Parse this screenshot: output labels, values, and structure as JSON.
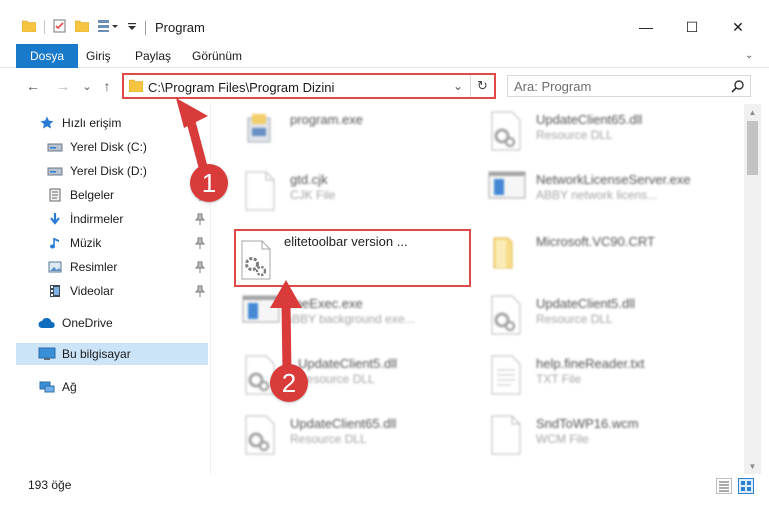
{
  "window": {
    "title": "Program",
    "minimize_glyph": "—",
    "maximize_glyph": "☐",
    "close_glyph": "✕"
  },
  "ribbon": {
    "tabs": [
      {
        "label": "Dosya",
        "active": true
      },
      {
        "label": "Giriş",
        "active": false
      },
      {
        "label": "Paylaş",
        "active": false
      },
      {
        "label": "Görünüm",
        "active": false
      }
    ],
    "expand_glyph": "⌄"
  },
  "navigation": {
    "back_glyph": "←",
    "forward_glyph": "→",
    "recent_glyph": "⌄",
    "up_glyph": "↑",
    "address": "C:\\Program Files\\Program Dizini",
    "address_drop_glyph": "⌄",
    "refresh_glyph": "↻",
    "search_placeholder": "Ara: Program"
  },
  "sidebar": {
    "items": [
      {
        "label": "Hızlı erişim",
        "icon": "star-icon",
        "pinned": false
      },
      {
        "label": "Yerel Disk (C:)",
        "icon": "drive-icon",
        "pinned": true
      },
      {
        "label": "Yerel Disk (D:)",
        "icon": "drive-icon",
        "pinned": true
      },
      {
        "label": "Belgeler",
        "icon": "documents-icon",
        "pinned": true
      },
      {
        "label": "İndirmeler",
        "icon": "download-icon",
        "pinned": true
      },
      {
        "label": "Müzik",
        "icon": "music-icon",
        "pinned": true
      },
      {
        "label": "Resimler",
        "icon": "pictures-icon",
        "pinned": true
      },
      {
        "label": "Videolar",
        "icon": "video-icon",
        "pinned": true
      },
      {
        "label": "OneDrive",
        "icon": "cloud-icon",
        "pinned": false
      },
      {
        "label": "Bu bilgisayar",
        "icon": "computer-icon",
        "pinned": false,
        "selected": true
      },
      {
        "label": "Ağ",
        "icon": "network-icon",
        "pinned": false
      }
    ],
    "pin_glyph": "📌"
  },
  "files": [
    {
      "name": "program.exe",
      "type": "",
      "icon": "installer-icon",
      "blurred": true
    },
    {
      "name": "UpdateClient65.dll",
      "type": "Resource DLL",
      "icon": "dll-icon",
      "blurred": true
    },
    {
      "name": "gtd.cjk",
      "type": "CJK File",
      "icon": "blank-file-icon",
      "blurred": true
    },
    {
      "name": "NetworkLicenseServer.exe",
      "type": "ABBY network licens...",
      "icon": "exe-window-icon",
      "blurred": true
    },
    {
      "name": "elitetoolbar version ...",
      "type": "",
      "icon": "settings-file-icon",
      "blurred": false,
      "highlighted": true
    },
    {
      "name": "Microsoft.VC90.CRT",
      "type": "",
      "icon": "folder-icon",
      "blurred": true
    },
    {
      "name": "FineExec.exe",
      "type": "ABBY background exe...",
      "icon": "exe-window-icon",
      "blurred": true
    },
    {
      "name": "UpdateClient5.dll",
      "type": "Resource DLL",
      "icon": "dll-icon",
      "blurred": true
    },
    {
      "name": "UpdateClient5.dll",
      "type": "Resource DLL",
      "icon": "dll-icon",
      "blurred": true
    },
    {
      "name": "help.fineReader.txt",
      "type": "TXT File",
      "icon": "text-file-icon",
      "blurred": true
    },
    {
      "name": "UpdateClient65.dll",
      "type": "Resource DLL",
      "icon": "dll-icon",
      "blurred": true
    },
    {
      "name": "SndToWP16.wcm",
      "type": "WCM File",
      "icon": "blank-file-icon",
      "blurred": true
    }
  ],
  "statusbar": {
    "item_count": "193 öğe"
  },
  "annotations": {
    "callout_1": "1",
    "callout_2": "2",
    "accent_color": "#d93a3a"
  },
  "colors": {
    "accent": "#1979ca",
    "selection": "#cce4f7",
    "highlight_border": "#e14848"
  }
}
